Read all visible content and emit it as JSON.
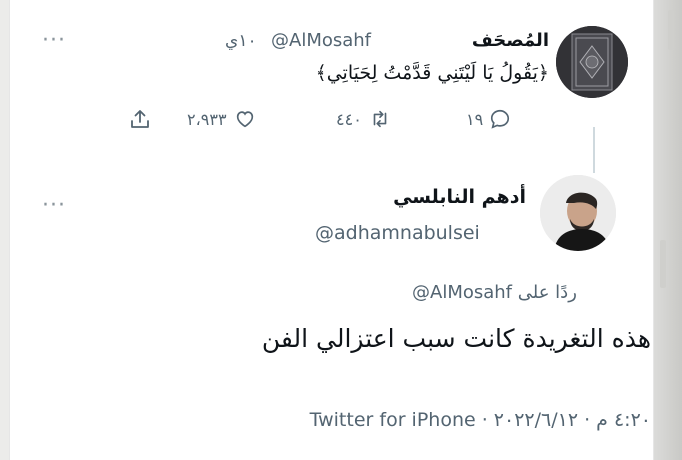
{
  "tweet1": {
    "display_name": "المُصحَف",
    "handle": "@AlMosahf",
    "time": "١٠ي",
    "text": "﴿يَقُولُ يَا لَيْتَنِي قَدَّمْتُ لِحَيَاتِي﴾",
    "replies": "١٩",
    "retweets": "٤٤٠",
    "likes": "٢،٩٣٣"
  },
  "tweet2": {
    "display_name": "أدهم النابلسي",
    "handle": "@adhamnabulsei",
    "reply_prefix": "ردًا على",
    "reply_to": "@AlMosahf",
    "text": "هذه التغريدة كانت سبب اعتزالي الفن",
    "meta": "Twitter for iPhone · ٤:٢٠ م · ٢٠٢٢/٦/١٢"
  },
  "icons": [
    "more-icon",
    "reply-icon",
    "retweet-icon",
    "like-icon",
    "share-icon"
  ],
  "colors": {
    "text": "#0f1419",
    "muted": "#536471",
    "line": "#cfd9de",
    "background": "#ffffff"
  }
}
